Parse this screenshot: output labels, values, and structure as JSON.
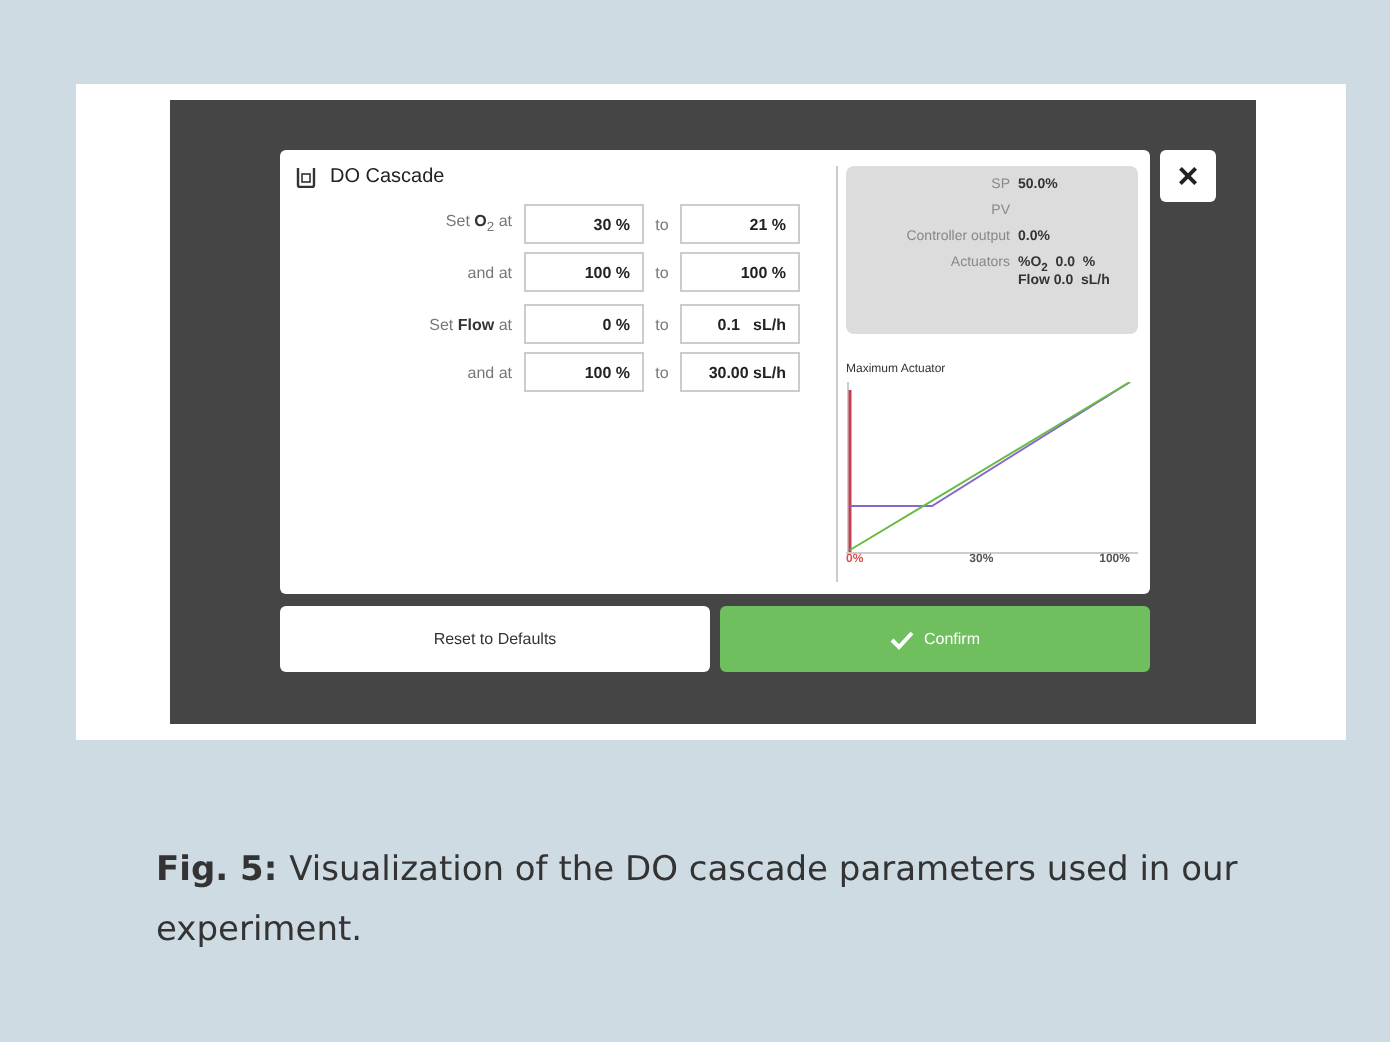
{
  "dialog": {
    "title": "DO Cascade",
    "rows": [
      {
        "label": "Set **O**$_{2}$ at",
        "from": "30 %",
        "to_label": "to",
        "to": "21 %"
      },
      {
        "label": "and at",
        "from": "100 %",
        "to_label": "to",
        "to": "100 %"
      },
      {
        "label": "Set **Flow** at",
        "from": "0 %",
        "to_label": "to",
        "to": "0.1   sL/h"
      },
      {
        "label": "and at",
        "from": "100 %",
        "to_label": "to",
        "to": "30.00 sL/h"
      }
    ],
    "status": [
      {
        "label": "SP",
        "value": "50.0%"
      },
      {
        "label": "PV"
      },
      {
        "label": "Controller output",
        "value": "0.0%"
      },
      {
        "label": "Actuators",
        "value": "%O$_{2}$  0.0  %",
        "value_2": "Flow 0.0  sL/h"
      }
    ],
    "chart": {
      "title": "Maximum Actuator",
      "x_labels": [
        "0%",
        "30%",
        "100%"
      ]
    }
  },
  "close_button": "×",
  "buttons": [
    {
      "label": "Reset to Defaults",
      "kind": "secondary"
    },
    {
      "label": "Confirm",
      "kind": "primary"
    }
  ],
  "caption": {
    "label": "Fig. 5:",
    "text": "Visualization of the DO cascade parameters used in our experiment."
  }
}
